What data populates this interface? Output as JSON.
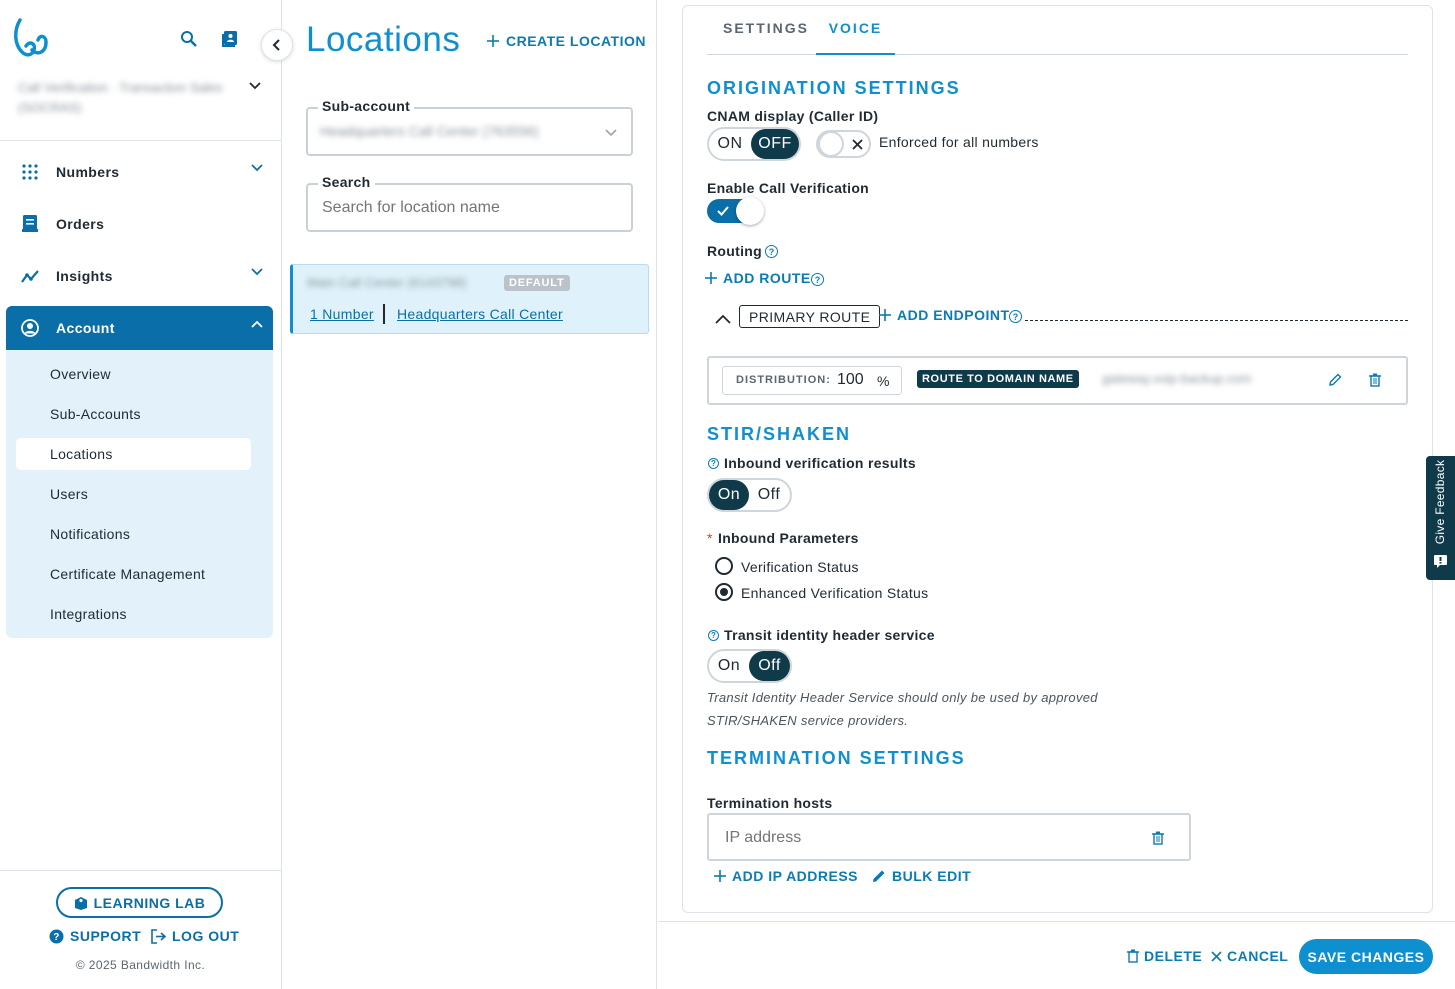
{
  "sidebar": {
    "account_name": "Call Verification · Transaction Sales (SOCRAS)",
    "nav": [
      {
        "label": "Numbers",
        "icon": "grid-dots-icon"
      },
      {
        "label": "Orders",
        "icon": "orders-icon"
      },
      {
        "label": "Insights",
        "icon": "trend-chart-icon"
      },
      {
        "label": "Account",
        "icon": "user-circle-icon"
      }
    ],
    "sub_items": [
      "Overview",
      "Sub-Accounts",
      "Locations",
      "Users",
      "Notifications",
      "Certificate Management",
      "Integrations"
    ],
    "learning_lab": "LEARNING LAB",
    "support": "SUPPORT",
    "logout": "LOG OUT",
    "copyright": "© 2025 Bandwidth Inc."
  },
  "middle": {
    "title": "Locations",
    "create_label": "CREATE LOCATION",
    "subaccount_label": "Sub-account",
    "subaccount_value": "Headquarters Call Center (763556)",
    "search_label": "Search",
    "search_placeholder": "Search for location name",
    "location": {
      "name": "Main Call Center (6143798)",
      "badge": "DEFAULT",
      "numbers_link": "1 Number",
      "subaccount_link": "Headquarters Call Center"
    }
  },
  "tabs": [
    "SETTINGS",
    "VOICE"
  ],
  "origination": {
    "title": "ORIGINATION SETTINGS",
    "cnam_label": "CNAM display (Caller ID)",
    "on": "ON",
    "off": "OFF",
    "enforced_label": "Enforced for all numbers",
    "call_verification_label": "Enable Call Verification",
    "routing_label": "Routing",
    "add_route": "ADD ROUTE",
    "primary_route": "PRIMARY ROUTE",
    "add_endpoint": "ADD ENDPOINT",
    "distribution_label": "DISTRIBUTION:",
    "distribution_value": "100",
    "percent": "%",
    "route_type": "ROUTE TO DOMAIN NAME",
    "route_target": "gateway.voip-backup.com"
  },
  "stir": {
    "title": "STIR/SHAKEN",
    "inbound_results_label": "Inbound verification results",
    "on": "On",
    "off": "Off",
    "required_mark": "*",
    "inbound_params_label": "Inbound Parameters",
    "radio_options": [
      "Verification Status",
      "Enhanced Verification Status"
    ],
    "selected_option": 1,
    "transit_label": "Transit identity header service",
    "transit_note_1": "Transit Identity Header Service should only be used by approved",
    "transit_note_2": "STIR/SHAKEN service providers."
  },
  "termination": {
    "title": "TERMINATION SETTINGS",
    "hosts_label": "Termination hosts",
    "ip_placeholder": "IP address",
    "add_ip": "ADD IP ADDRESS",
    "bulk_edit": "BULK EDIT"
  },
  "footer": {
    "delete": "DELETE",
    "cancel": "CANCEL",
    "save": "SAVE CHANGES"
  },
  "feedback": "Give Feedback",
  "colors": {
    "accent": "#0d8fd0",
    "dark_toggle": "#0f3a4a",
    "sidebar_active": "#0a6fa8",
    "subnav_bg": "#e3f1fb",
    "selected_card": "#dff2fb"
  }
}
